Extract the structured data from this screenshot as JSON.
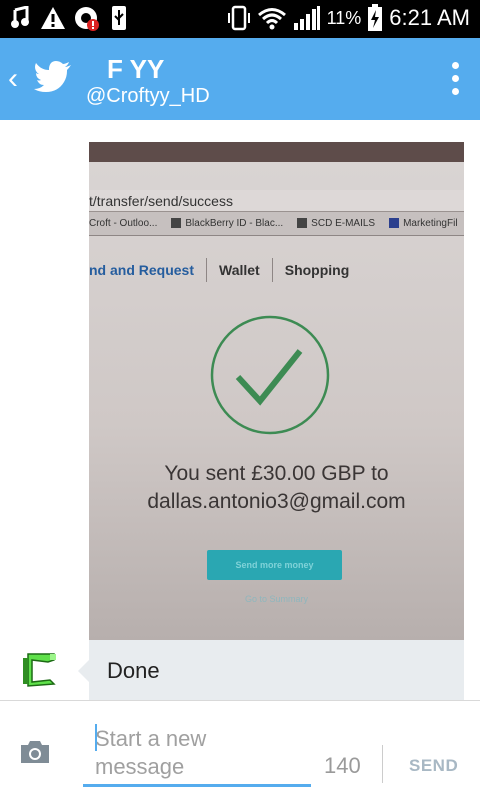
{
  "status_bar": {
    "battery": "11%",
    "time": "6:21 AM",
    "icons": [
      "music-note-icon",
      "warning-icon",
      "notification-icon",
      "usb-icon",
      "vibrate-icon",
      "wifi-icon",
      "signal-icon",
      "battery-charging-icon"
    ]
  },
  "app_bar": {
    "title": "F YY",
    "subtitle": "@Croftyy_HD",
    "back_icon": "chevron-left-icon",
    "logo_icon": "twitter-bird-icon",
    "menu_icon": "overflow-menu-icon",
    "color": "#55acee"
  },
  "photo": {
    "url": "t/transfer/send/success",
    "bookmarks": [
      "Croft - Outloo...",
      "BlackBerry ID - Blac...",
      "SCD E-MAILS",
      "MarketingFil"
    ],
    "tabs": [
      "nd and Request",
      "Wallet",
      "Shopping"
    ],
    "sent_line1": "You sent £30.00 GBP to",
    "sent_line2": "dallas.antonio3@gmail.com",
    "button": "Send more money",
    "link": "Go to Summary"
  },
  "message": {
    "text": "Done"
  },
  "compose": {
    "placeholder": "Start a new message",
    "counter": "140",
    "send_label": "SEND",
    "camera_icon": "camera-icon"
  }
}
